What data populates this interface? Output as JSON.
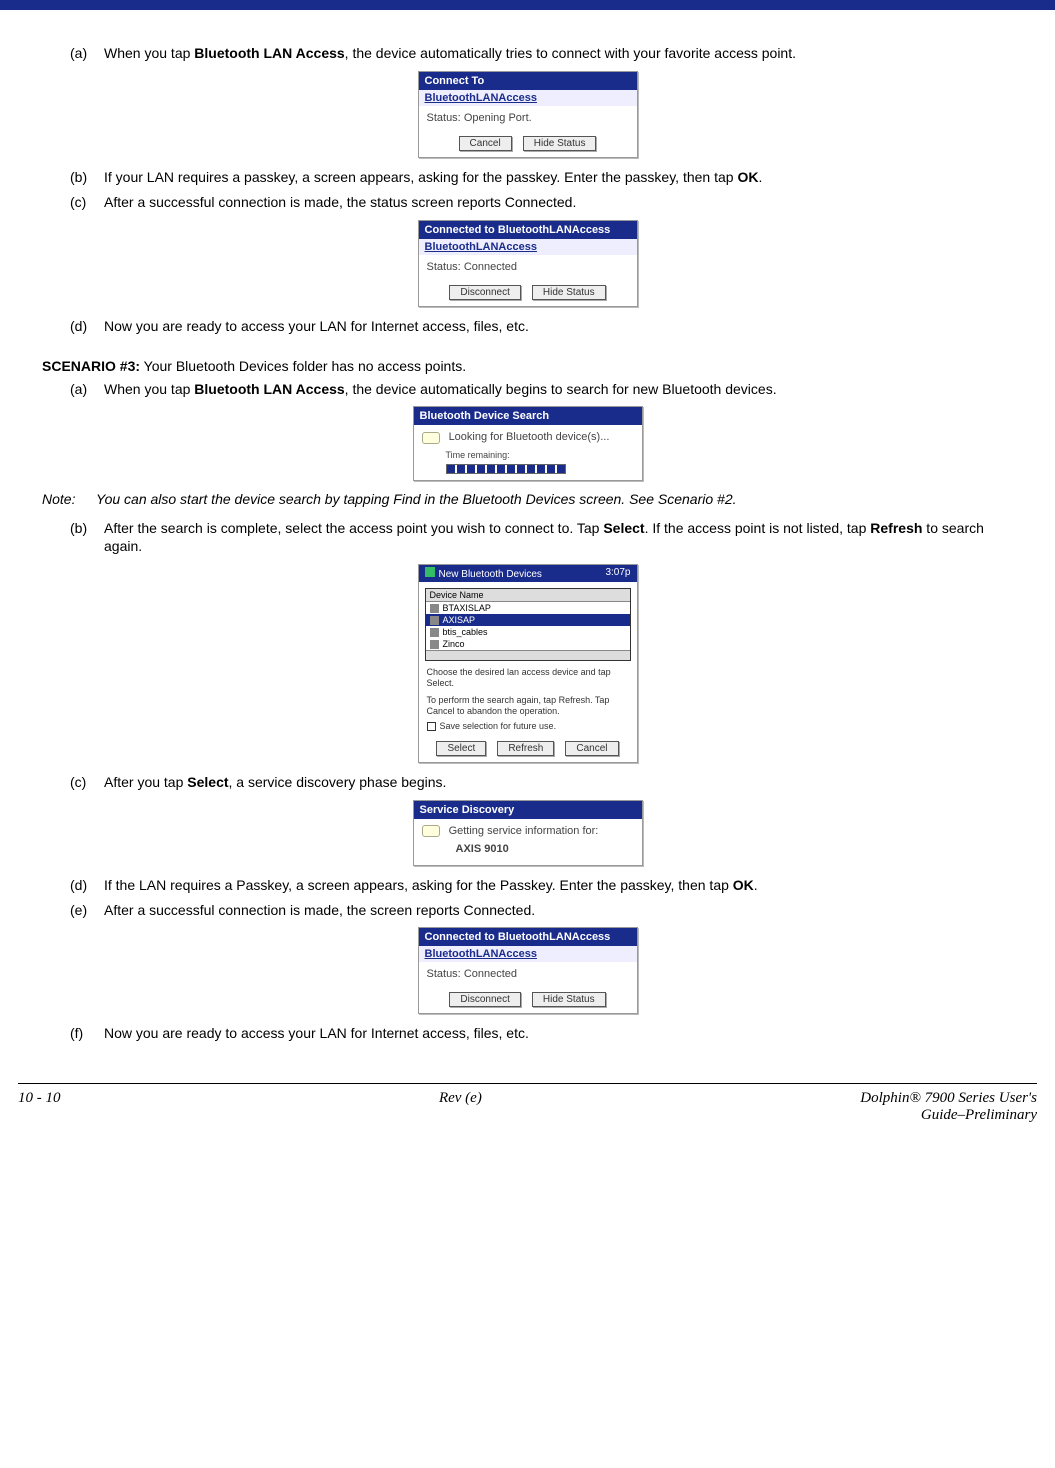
{
  "s2": {
    "a_pre": "When you tap ",
    "a_bold": "Bluetooth LAN Access",
    "a_post": ", the device automatically tries to connect with your favorite access point.",
    "b_pre": "If your LAN requires a passkey, a screen appears, asking for the passkey. Enter the passkey, then tap ",
    "b_bold": "OK",
    "b_post": ".",
    "c": "After a successful connection is made, the status screen reports Connected.",
    "d": "Now you are ready to access your LAN for Internet access, files, etc."
  },
  "dlg_connect": {
    "title": "Connect To",
    "link": "BluetoothLANAccess",
    "status_label": "Status:",
    "status_value": "Opening Port.",
    "btn_cancel": "Cancel",
    "btn_hide": "Hide Status"
  },
  "dlg_connected": {
    "title": "Connected to BluetoothLANAccess",
    "link": "BluetoothLANAccess",
    "status_label": "Status:",
    "status_value": "Connected",
    "btn_disc": "Disconnect",
    "btn_hide": "Hide Status"
  },
  "s3": {
    "label": "SCENARIO #3:",
    "intro": " Your Bluetooth Devices folder has no access points.",
    "a_pre": "When you tap ",
    "a_bold": "Bluetooth LAN Access",
    "a_post": ", the device automatically begins to search for new Bluetooth devices.",
    "note_label": "Note:",
    "note_text": "You can also start the device search by tapping Find in the Bluetooth Devices screen. See Scenario #2.",
    "b_pre": "After the search is complete, select the access point you wish to connect to. Tap ",
    "b_bold1": "Select",
    "b_mid": ". If the access point is not listed, tap ",
    "b_bold2": "Refresh",
    "b_post": " to search again.",
    "c_pre": "After you tap ",
    "c_bold": "Select",
    "c_post": ", a service discovery phase begins.",
    "d_pre": "If the LAN requires a Passkey, a screen appears, asking for the Passkey. Enter the passkey, then tap ",
    "d_bold": "OK",
    "d_post": ".",
    "e": "After a successful connection is made, the screen reports Connected.",
    "f": "Now you are ready to access your LAN for Internet access, files, etc."
  },
  "dlg_search": {
    "title": "Bluetooth Device Search",
    "msg": "Looking for Bluetooth device(s)...",
    "time": "Time remaining:"
  },
  "dlg_newdev": {
    "title": "New Bluetooth Devices",
    "clock": "3:07p",
    "col": "Device Name",
    "rows": [
      "BTAXISLAP",
      "AXISAP",
      "btis_cables",
      "Zinco"
    ],
    "p1": "Choose the desired lan access device and tap Select.",
    "p2": "To perform the search again, tap Refresh. Tap Cancel to abandon the operation.",
    "chk": "Save selection for future use.",
    "btn_sel": "Select",
    "btn_ref": "Refresh",
    "btn_can": "Cancel"
  },
  "dlg_service": {
    "title": "Service Discovery",
    "msg": "Getting service information for:",
    "dev": "AXIS 9010"
  },
  "footer": {
    "left": "10 - 10",
    "center": "Rev (e)",
    "right1": "Dolphin® 7900 Series User's",
    "right2": "Guide–Preliminary"
  },
  "markers": {
    "a": "(a)",
    "b": "(b)",
    "c": "(c)",
    "d": "(d)",
    "e": "(e)",
    "f": "(f)"
  }
}
